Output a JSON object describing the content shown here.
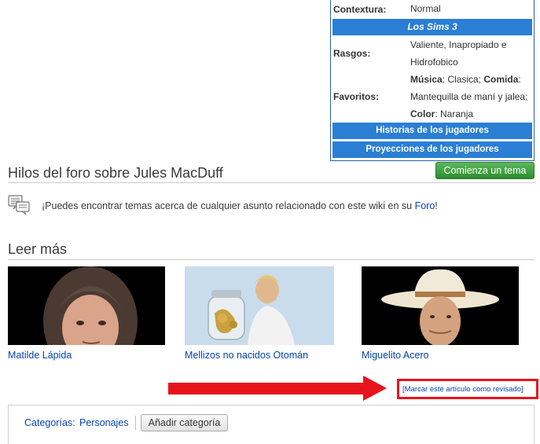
{
  "infobox": {
    "contextura_label": "Contextura:",
    "contextura_value": "Normal",
    "sims3_header": "Los Sims 3",
    "rasgos_label": "Rasgos:",
    "rasgos_value": "Valiente, Inapropiado e Hidrofobico",
    "favoritos_label": "Favoritos:",
    "musica_label": "Música",
    "musica_value": ": Clasica; ",
    "comida_label": "Comida",
    "comida_value": ": Mantequilla de maní y jalea;",
    "color_label": "Color",
    "color_value": ": Naranja",
    "historias_header": "Historias de los jugadores",
    "proyecciones_header": "Proyecciones de los jugadores"
  },
  "forum": {
    "title": "Hilos del foro sobre Jules MacDuff",
    "start_button": "Comienza un tema",
    "text_before": "¡Puedes encontrar temas acerca de cualquier asunto relacionado con este wiki en su ",
    "link": "Foro",
    "text_after": "!"
  },
  "read_more": {
    "title": "Leer más",
    "cards": [
      {
        "label": "Matilde Lápida"
      },
      {
        "label": "Mellizos no nacidos Otomán"
      },
      {
        "label": "Miguelito Acero"
      }
    ]
  },
  "review": {
    "mark_link": "[Marcar este artículo como revisado]"
  },
  "categories": {
    "label": "Categorías:",
    "item": "Personajes",
    "add_button": "Añadir categoría"
  },
  "colors": {
    "accent_blue": "#2a7fd4",
    "link_blue": "#0645ad",
    "button_green": "#3a9a3a",
    "annotation_red": "#e8141c"
  }
}
